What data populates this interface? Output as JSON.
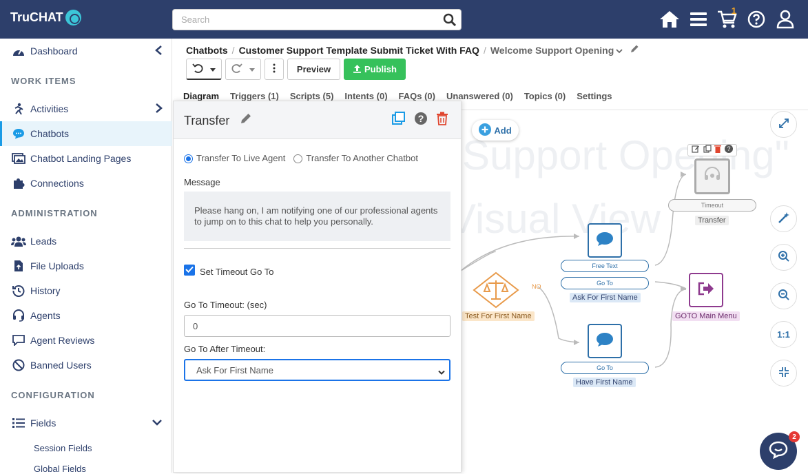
{
  "app": {
    "logo": "TruCHAT"
  },
  "header": {
    "search_placeholder": "Search",
    "cart_count": "1"
  },
  "sidebar": {
    "dashboard": "Dashboard",
    "work_items_heading": "WORK ITEMS",
    "activities": "Activities",
    "chatbots": "Chatbots",
    "chatbot_landing_pages": "Chatbot Landing Pages",
    "connections": "Connections",
    "administration_heading": "ADMINISTRATION",
    "leads": "Leads",
    "file_uploads": "File Uploads",
    "history": "History",
    "agents": "Agents",
    "agent_reviews": "Agent Reviews",
    "banned_users": "Banned Users",
    "configuration_heading": "CONFIGURATION",
    "fields": "Fields",
    "session_fields": "Session Fields",
    "global_fields": "Global Fields"
  },
  "breadcrumb": {
    "root": "Chatbots",
    "bot": "Customer Support Template Submit Ticket With FAQ",
    "current": "Welcome Support Opening"
  },
  "toolbar": {
    "preview": "Preview",
    "publish": "Publish"
  },
  "tabs": [
    "Diagram",
    "Triggers (1)",
    "Scripts (5)",
    "Intents (0)",
    "FAQs (0)",
    "Unanswered (0)",
    "Topics (0)",
    "Settings"
  ],
  "canvas": {
    "add_label": "Add",
    "watermark_1": "Support Opening\"",
    "watermark_2": "Visual View",
    "node_timeout_pill": "Timeout",
    "node_transfer_label": "Transfer",
    "node_freetext_pill": "Free Text",
    "node_goto_pill": "Go To",
    "node_ask_label": "Ask For First Name",
    "node_test_label": "Test For First Name",
    "node_no_label": "NO",
    "node_goto2_pill": "Go To",
    "node_have_label": "Have First Name",
    "node_goto_main_label": "GOTO Main Menu",
    "ratio_label": "1:1"
  },
  "panel": {
    "title": "Transfer",
    "radio_live_agent": "Transfer To Live Agent",
    "radio_another_bot": "Transfer To Another Chatbot",
    "message_label": "Message",
    "message_text": "Please hang on, I am notifying one of our professional agents to jump on to this chat to help you personally.",
    "timeout_checkbox": "Set Timeout Go To",
    "timeout_label": "Go To Timeout: (sec)",
    "timeout_value": "0",
    "after_timeout_label": "Go To After Timeout:",
    "after_timeout_value": "Ask For First Name"
  },
  "chat_widget": {
    "badge": "2"
  },
  "colors": {
    "header": "#2d3f6b",
    "accent": "#1a9be6",
    "publish": "#36c15b",
    "danger": "#e0462f"
  }
}
